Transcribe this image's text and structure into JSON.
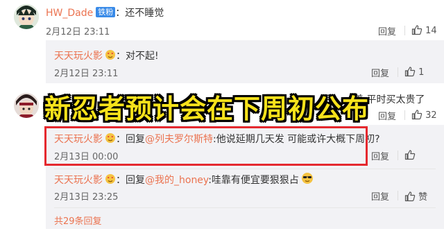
{
  "comments": [
    {
      "user": "HW_Dade",
      "badge": "铁粉",
      "text": "：还不睡觉",
      "time": "2月12日 23:11",
      "reply_label": "回复",
      "likes": "14"
    }
  ],
  "sub1": {
    "user": "天天玩火影",
    "text": "：对不起!",
    "time": "2月12日 23:11",
    "reply_label": "回复",
    "likes": "1"
  },
  "comment2": {
    "text_tail": "着 平时买太贵了",
    "reply_label": "回复",
    "likes": "32"
  },
  "sub2": {
    "user": "天天玩火影",
    "prefix": "：回复",
    "mention": "@列夫罗尔斯特",
    "text": ":他说延期几天发 可能或许大概下周初?",
    "time": "2月13日 00:00",
    "reply_label": "回复"
  },
  "sub3": {
    "user": "天天玩火影",
    "prefix": "：回复",
    "mention": "@我的_honey",
    "text": ":哇靠有便宜要狠狠占",
    "time": "2月13日 23:25",
    "reply_label": "回复",
    "like_label": "赞"
  },
  "more_replies": "共29条回复",
  "banner": "新忍者预计会在下周初公布",
  "colors": {
    "accent": "#eb7350",
    "badge": "#3a8be8",
    "banner_text": "#f7e21b",
    "highlight_box": "#e5292f"
  }
}
